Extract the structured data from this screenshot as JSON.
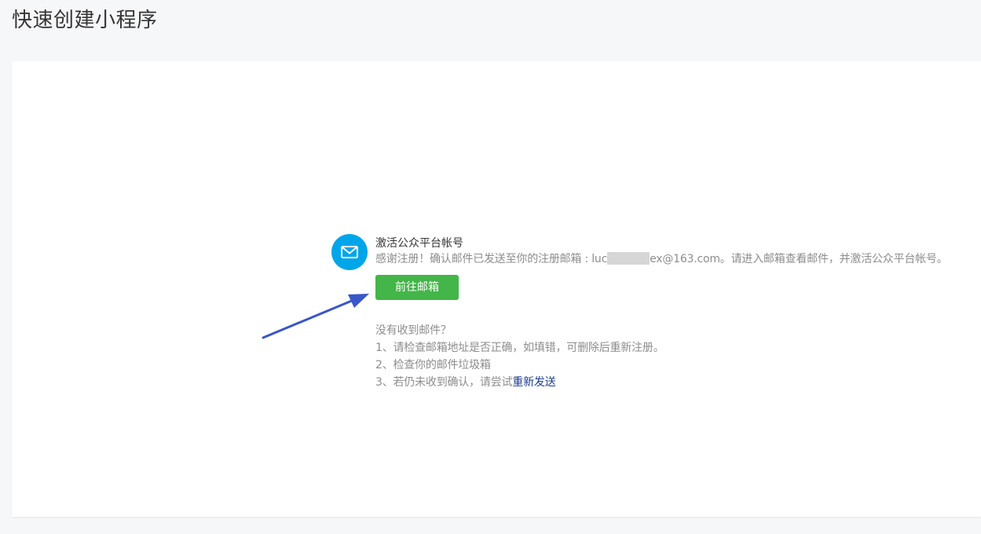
{
  "page": {
    "title": "快速创建小程序"
  },
  "activation": {
    "heading": "激活公众平台帐号",
    "desc_prefix": "感谢注册！确认邮件已发送至你的注册邮箱 : luc",
    "desc_suffix": "ex@163.com。请进入邮箱查看邮件，并激活公众平台帐号。",
    "button_label": "前往邮箱"
  },
  "help": {
    "title": "没有收到邮件？",
    "item1": "1、请检查邮箱地址是否正确，如填错，可删除后重新注册。",
    "item2": "2、检查你的邮件垃圾箱",
    "item3_prefix": "3、若仍未收到确认，请尝试",
    "resend_label": "重新发送"
  },
  "colors": {
    "icon_bg": "#00a6e9",
    "button_bg": "#44b549",
    "link": "#1e3d8f",
    "arrow": "#3a56c8"
  },
  "icons": {
    "status_icon": "mail-icon",
    "annotation": "arrow-icon"
  }
}
